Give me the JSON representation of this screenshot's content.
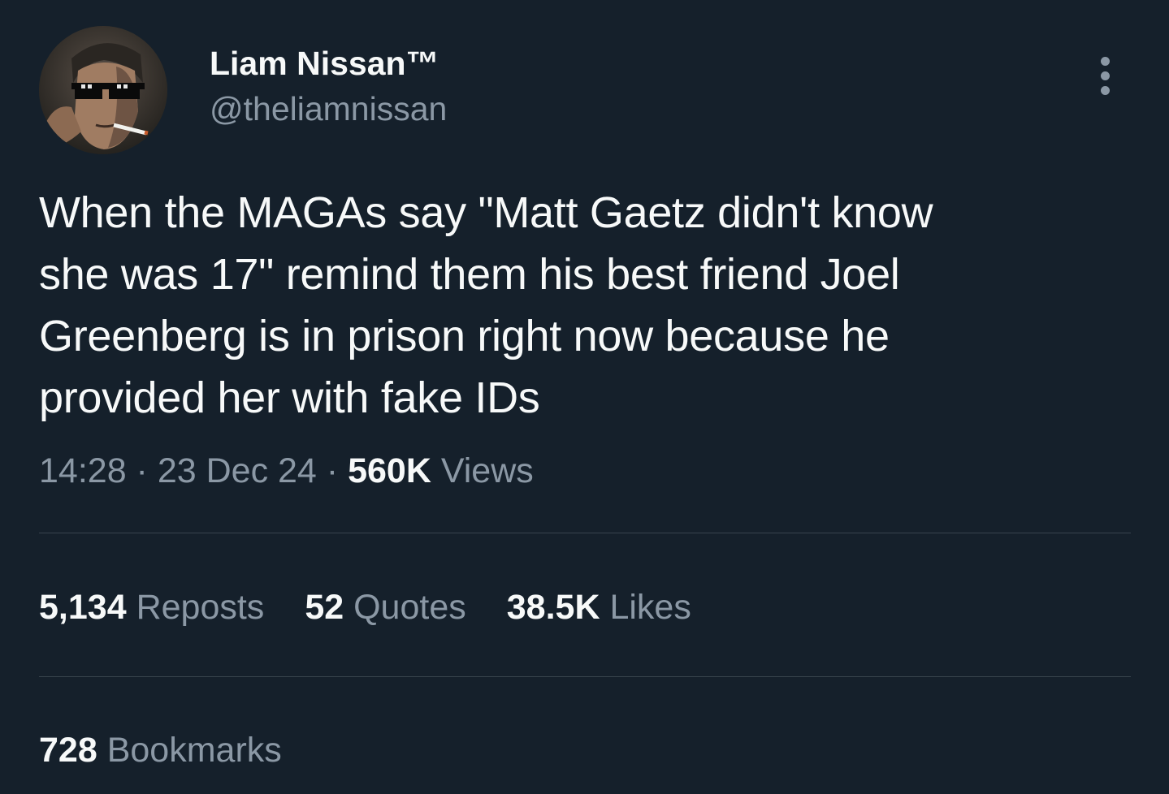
{
  "author": {
    "display_name": "Liam Nissan™",
    "handle": "@theliamnissan",
    "avatar_icon": "profile-avatar"
  },
  "more_icon": "more-options-icon",
  "tweet": {
    "lines": [
      "When the MAGAs say \"Matt Gaetz didn't know",
      "she was 17\" remind them his best friend Joel",
      "Greenberg is in prison right now because he",
      "provided her with fake IDs"
    ]
  },
  "meta": {
    "time": "14:28",
    "separator": " · ",
    "date": "23 Dec 24",
    "views_count": "560K",
    "views_label": "Views"
  },
  "stats": {
    "reposts_count": "5,134",
    "reposts_label": "Reposts",
    "quotes_count": "52",
    "quotes_label": "Quotes",
    "likes_count": "38.5K",
    "likes_label": "Likes"
  },
  "bookmarks": {
    "count": "728",
    "label": "Bookmarks"
  },
  "colors": {
    "background": "#15202b",
    "primary_text": "#f7f9f9",
    "secondary_text": "#8b98a5",
    "divider": "#38444d"
  }
}
